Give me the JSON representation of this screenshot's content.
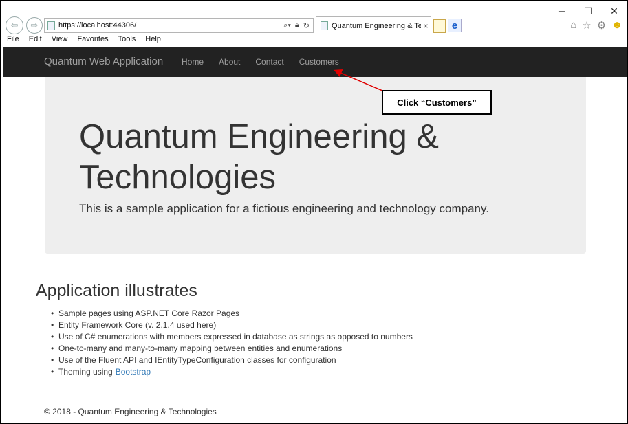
{
  "window_controls": {
    "minimize": "─",
    "maximize": "☐",
    "close": "✕"
  },
  "browser": {
    "address_url": "https://localhost:44306/",
    "tab_title": "Quantum Engineering & Te...",
    "tab_close": "×",
    "menu": [
      "File",
      "Edit",
      "View",
      "Favorites",
      "Tools",
      "Help"
    ],
    "icons": {
      "back": "back-arrow-icon",
      "forward": "forward-arrow-icon",
      "search": "search-icon",
      "lock": "lock-icon",
      "refresh": "refresh-icon",
      "home": "home-icon",
      "favorites": "star-icon",
      "settings": "gear-icon",
      "feedback": "smiley-icon"
    }
  },
  "navbar": {
    "brand": "Quantum Web Application",
    "links": [
      "Home",
      "About",
      "Contact",
      "Customers"
    ],
    "background": "#222222"
  },
  "jumbotron": {
    "title": "Quantum Engineering & Technologies",
    "lead": "This is a sample application for a fictious engineering and technology company."
  },
  "callout": {
    "text": "Click “Customers”",
    "arrow_color": "#e00000"
  },
  "main": {
    "heading": "Application illustrates",
    "items": [
      "Sample pages using ASP.NET Core Razor Pages",
      "Entity Framework Core (v. 2.1.4 used here)",
      "Use of C# enumerations with members expressed in database as strings as opposed to numbers",
      "One-to-many and many-to-many mapping between entities and enumerations",
      "Use of the Fluent API and IEntityTypeConfiguration classes for configuration",
      "Theming using"
    ],
    "theming_link": "Bootstrap",
    "link_color": "#337ab7"
  },
  "footer": {
    "text": "© 2018 - Quantum Engineering & Technologies"
  }
}
